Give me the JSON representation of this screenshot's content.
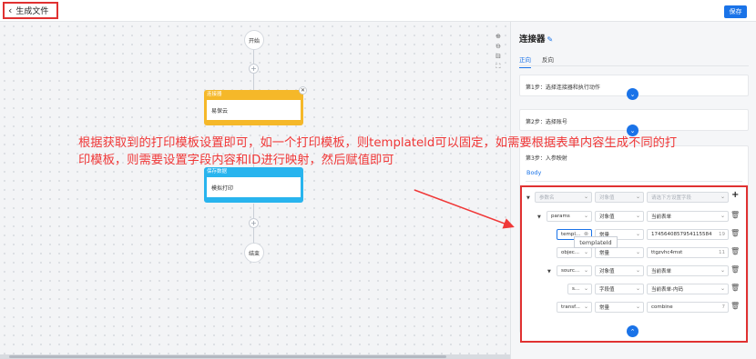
{
  "header": {
    "title": "生成文件",
    "save_label": "保存"
  },
  "canvas": {
    "start_label": "开始",
    "end_label": "结束",
    "node1": {
      "title": "连接器",
      "body": "易保云"
    },
    "node2": {
      "title": "保存数据",
      "body": "模拟打印"
    },
    "zoom_icons": [
      "zoom-in-icon",
      "zoom-out-icon",
      "fit-icon",
      "fullscreen-icon"
    ]
  },
  "annotation": {
    "text": "根据获取到的打印模板设置即可，如一个打印模板，则templateld可以固定，如需要根据表单内容生成不同的打印模板，则需要设置字段内容和ID进行映射，然后赋值即可"
  },
  "panel": {
    "title": "连接器",
    "tabs": [
      {
        "label": "正向"
      },
      {
        "label": "反向"
      }
    ],
    "step1": "第1步：选择连接器和执行动作",
    "step2": "第2步：选择账号",
    "step3": "第3步：入参映射",
    "body_tab": "Body",
    "table_header": {
      "name": "参数名",
      "type": "对象值",
      "value": "请选下方设置字段"
    },
    "rows": [
      {
        "name": "params",
        "type": "对象值",
        "value": "当前表单",
        "count": ""
      },
      {
        "name": "templ...",
        "type": "常量",
        "value": "1745640857954115584",
        "count": "19"
      },
      {
        "name": "objec...",
        "type": "常量",
        "value": "ttgzvhc4mst",
        "count": "11"
      },
      {
        "name": "sourc...",
        "type": "对象值",
        "value": "当前表单",
        "count": ""
      },
      {
        "name": "s...",
        "type": "字段值",
        "value": "当前表单-内码",
        "count": ""
      },
      {
        "name": "transf...",
        "type": "常量",
        "value": "combine",
        "count": "7"
      }
    ],
    "tooltip": "templateId"
  },
  "colors": {
    "accent": "#1a73e8",
    "annotation": "#f03838",
    "node_yellow": "#f5b829",
    "node_blue": "#28b4ee"
  }
}
